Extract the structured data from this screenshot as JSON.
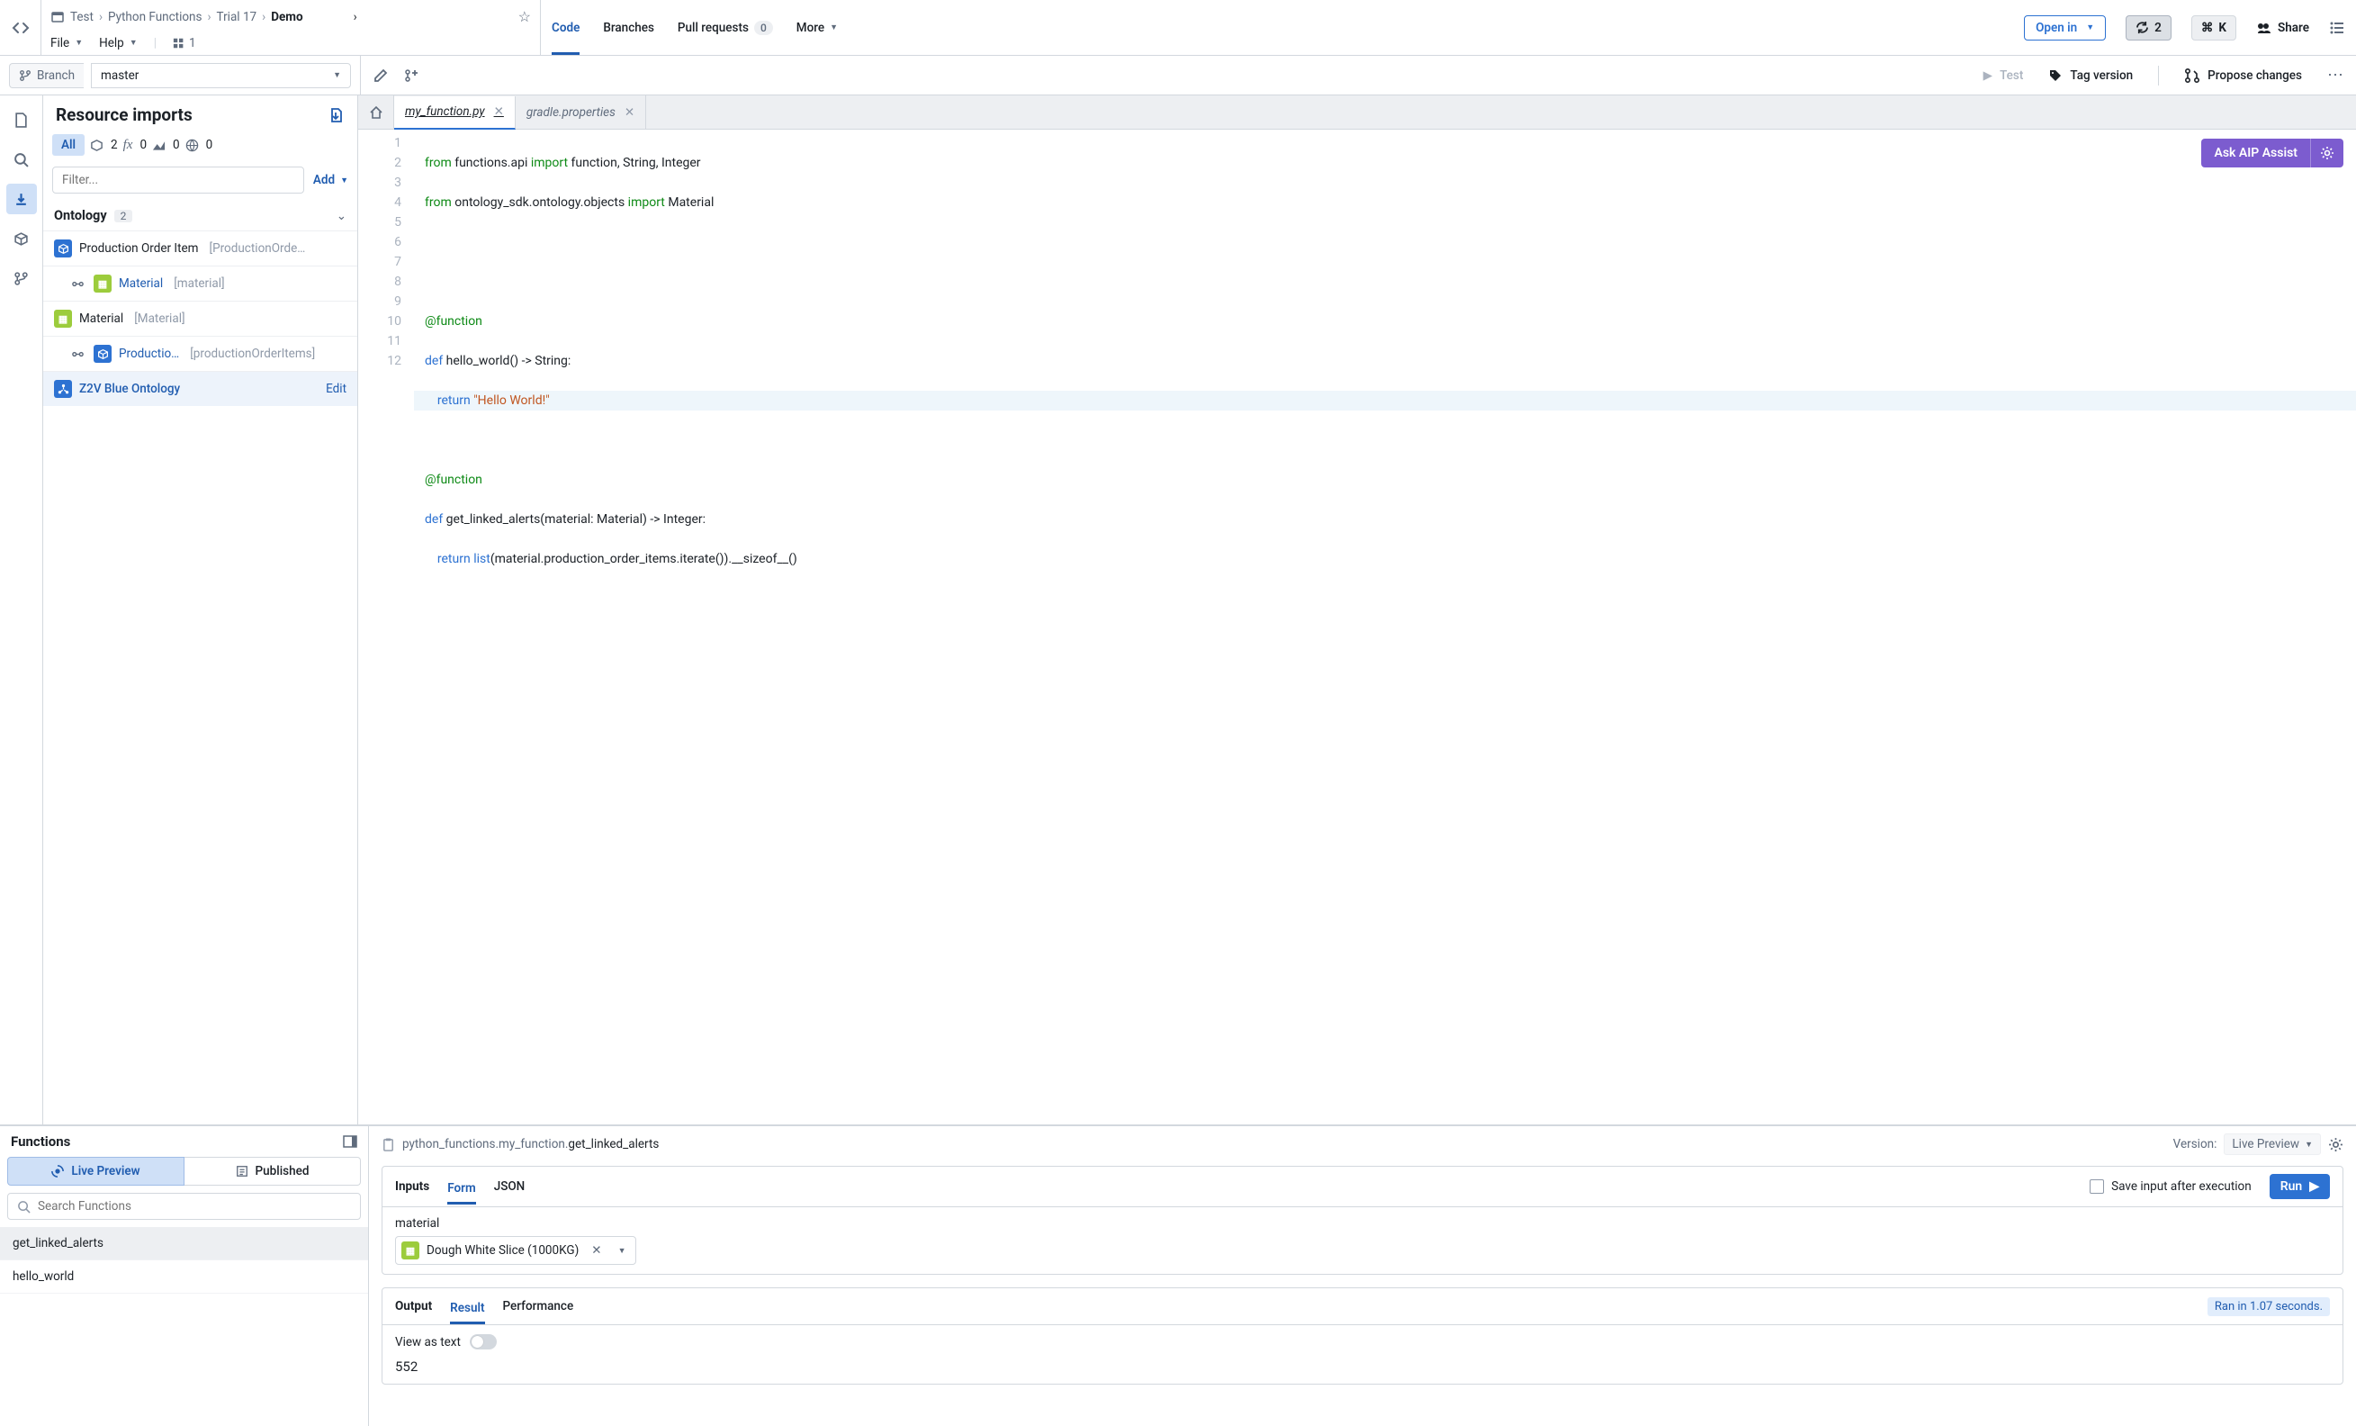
{
  "breadcrumbs": {
    "seg1": "Test",
    "seg2": "Python Functions",
    "seg3": "Trial 17",
    "current": "Demo",
    "ellipsis": "›"
  },
  "menus": {
    "file": "File",
    "help": "Help",
    "repo_count": "1"
  },
  "top_tabs": {
    "code": "Code",
    "branches": "Branches",
    "pull_requests": "Pull requests",
    "pr_count": "0",
    "more": "More"
  },
  "header_actions": {
    "open_in": "Open in",
    "sync": "2",
    "cmd": "K",
    "share": "Share"
  },
  "branch": {
    "label": "Branch",
    "value": "master"
  },
  "toolbar_right": {
    "test": "Test",
    "tag": "Tag version",
    "propose": "Propose changes"
  },
  "sidebar": {
    "title": "Resource imports",
    "filterAll": "All",
    "counts": {
      "obj": "2",
      "fn": "0",
      "dash": "0",
      "web": "0"
    },
    "filter_placeholder": "Filter...",
    "add": "Add",
    "section_ontology": "Ontology",
    "section_count": "2",
    "items": {
      "poi_name": "Production Order Item",
      "poi_sub": "[ProductionOrde…",
      "mat1_name": "Material",
      "mat1_sub": "[material]",
      "mat2_name": "Material",
      "mat2_sub": "[Material]",
      "prod_name": "Productio…",
      "prod_sub": "[productionOrderItems]"
    },
    "footer": {
      "name": "Z2V Blue Ontology",
      "edit": "Edit"
    }
  },
  "file_tabs": {
    "active": "my_function.py",
    "other": "gradle.properties"
  },
  "code": {
    "l1a": "from",
    "l1b": " functions.api ",
    "l1c": "import",
    "l1d": " function, String, Integer",
    "l2a": "from",
    "l2b": " ontology_sdk.ontology.objects ",
    "l2c": "import",
    "l2d": " Material",
    "l5": "@function",
    "l6a": "def",
    "l6b": " hello_world() -> String:",
    "l7a": "    return ",
    "l7b": "\"Hello World!\"",
    "l9": "@function",
    "l10a": "def",
    "l10b": " get_linked_alerts(material: Material) -> Integer:",
    "l11a": "    return ",
    "l11b": "list",
    "l11c": "(material.production_order_items.iterate()).__sizeof__()"
  },
  "line_numbers": [
    "1",
    "2",
    "3",
    "4",
    "5",
    "6",
    "7",
    "8",
    "9",
    "10",
    "11",
    "12"
  ],
  "ai_button": "Ask AIP Assist",
  "functions": {
    "title": "Functions",
    "live": "Live Preview",
    "published": "Published",
    "search_placeholder": "Search Functions",
    "list": {
      "a": "get_linked_alerts",
      "b": "hello_world"
    }
  },
  "run": {
    "clipboard": "📋",
    "path": "python_functions.my_function.",
    "leaf": "get_linked_alerts",
    "version_label": "Version:",
    "version_value": "Live Preview",
    "inputs_title": "Inputs",
    "tab_form": "Form",
    "tab_json": "JSON",
    "save_label": "Save input after execution",
    "run_btn": "Run",
    "param": "material",
    "param_value": "Dough White Slice (1000KG)",
    "output_title": "Output",
    "tab_result": "Result",
    "tab_perf": "Performance",
    "status": "Ran in 1.07 seconds.",
    "view_as_text": "View as text",
    "result_value": "552"
  }
}
